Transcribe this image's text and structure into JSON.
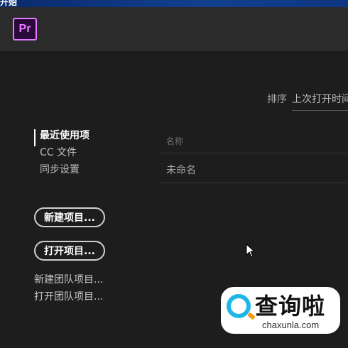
{
  "window": {
    "title": "开始"
  },
  "app": {
    "logo_text": "Pr"
  },
  "sort": {
    "label": "排序",
    "value": "上次打开时间"
  },
  "nav": {
    "items": [
      {
        "label": "最近使用项",
        "active": true
      },
      {
        "label": "CC 文件",
        "active": false
      },
      {
        "label": "同步设置",
        "active": false
      }
    ]
  },
  "buttons": {
    "new_project": "新建项目...",
    "open_project": "打开项目..."
  },
  "links": {
    "new_team_project": "新建团队项目...",
    "open_team_project": "打开团队项目..."
  },
  "table": {
    "column_name": "名称",
    "rows": [
      {
        "name": "未命名"
      }
    ]
  },
  "watermark": {
    "text": "查询啦",
    "domain": "chaxunla.com"
  },
  "colors": {
    "accent": "#e77bff",
    "background": "#1d1d1d",
    "header": "#2b2b2b"
  }
}
